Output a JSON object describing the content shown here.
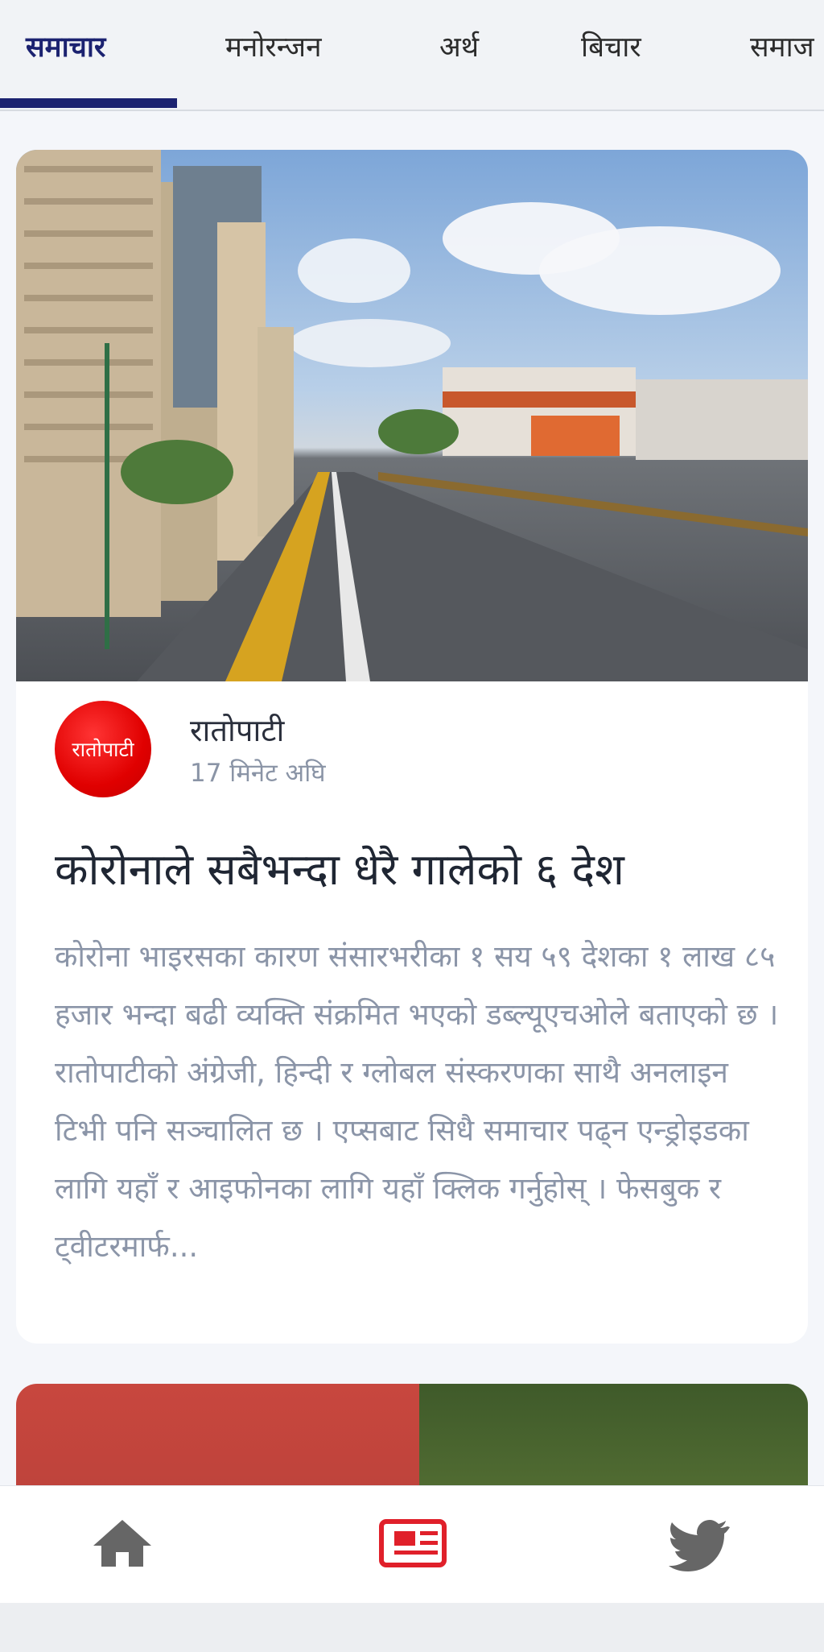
{
  "tabs": [
    {
      "label": "समाचार",
      "active": true
    },
    {
      "label": "मनोरन्जन",
      "active": false
    },
    {
      "label": "अर्थ",
      "active": false
    },
    {
      "label": "बिचार",
      "active": false
    },
    {
      "label": "समाज",
      "active": false
    }
  ],
  "article": {
    "source_name": "रातोपाटी",
    "source_logo_text": "रातोपाटी",
    "time_ago": "17 मिनेट अघि",
    "headline": "कोरोनाले सबैभन्दा धेरै गालेको ६ देश",
    "excerpt": "कोरोना भाइरसका कारण संसारभरीका १ सय ५९ देशका १ लाख ८५ हजार भन्दा बढी व्यक्ति संक्रमित भएको डब्ल्यूएचओले बताएको छ ।रातोपाटीको अंग्रेजी, हिन्दी र ग्लोबल संस्करणका साथै अनलाइन टिभी पनि सञ्चालित छ । एप्सबाट सिधै समाचार पढ्न एन्ड्रोइडका लागि यहाँ र आइफोनका लागि यहाँ क्लिक गर्नुहोस् । फेसबुक र ट्वीटरमार्फ..."
  },
  "bottom_nav": [
    {
      "icon": "home-icon",
      "active": false
    },
    {
      "icon": "newspaper-icon",
      "active": true
    },
    {
      "icon": "twitter-icon",
      "active": false
    }
  ],
  "colors": {
    "accent": "#1b2270",
    "active_nav": "#e0202a",
    "inactive_nav": "#666666"
  }
}
